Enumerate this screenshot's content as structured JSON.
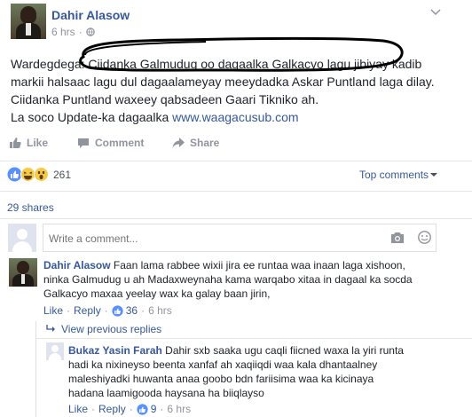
{
  "post": {
    "author": "Dahir Alasow",
    "time": "6 hrs",
    "time_separator": "·",
    "text_lines": [
      "Wardegdega: Ciidanka Galmudug oo dagaalka Galkacyo lagu jibiyay kadib",
      "markii halsaac lagu dul dagaalameyay meeydadka Askar Puntland laga dilay.",
      "Ciidanka Puntland waxeey qabsadeen Gaari Tikniko ah."
    ],
    "update_prefix": "La soco Update-ka dagaalka ",
    "link_text": "www.waagacusub.com"
  },
  "actions": {
    "like": "Like",
    "comment": "Comment",
    "share": "Share"
  },
  "reactions": {
    "count": "261",
    "top_comments": "Top comments",
    "shares": "29 shares"
  },
  "composer": {
    "placeholder": "Write a comment..."
  },
  "comments": [
    {
      "author": "Dahir Alasow",
      "lines": [
        "Faan lama rabbee wixii jira ee runtaa waa inaan laga xishoon,",
        "ninka Galmudug u ah Madaxweynaha kama warqabo xitaa in dagaal ka socda",
        "Galkacyo maxaa yeelay wax ka galay baan jirin,"
      ],
      "like": "Like",
      "reply": "Reply",
      "dot": "·",
      "likes": "36",
      "time": "6 hrs"
    }
  ],
  "view_previous": "View previous replies",
  "reply": {
    "author": "Bukaz Yasin Farah",
    "lines": [
      "Dahir sxb saaka ugu caqli fiicned waxa la yiri runta",
      "hadi ka nixineyso beenta xanfaf ah xaqiiqdi waa kala dhantaalney",
      "maleshiyadki huwanta anaa goobo bdn fariisima waa ka kicinaya",
      "hadana laamigooda haysana ha biiqlayso"
    ],
    "like": "Like",
    "reply": "Reply",
    "dot": "·",
    "likes": "9",
    "time": "6 hrs"
  },
  "colors": {
    "link": "#365899",
    "muted": "#90949c",
    "like_blue": "#5890ff",
    "annotation": "#000000"
  }
}
